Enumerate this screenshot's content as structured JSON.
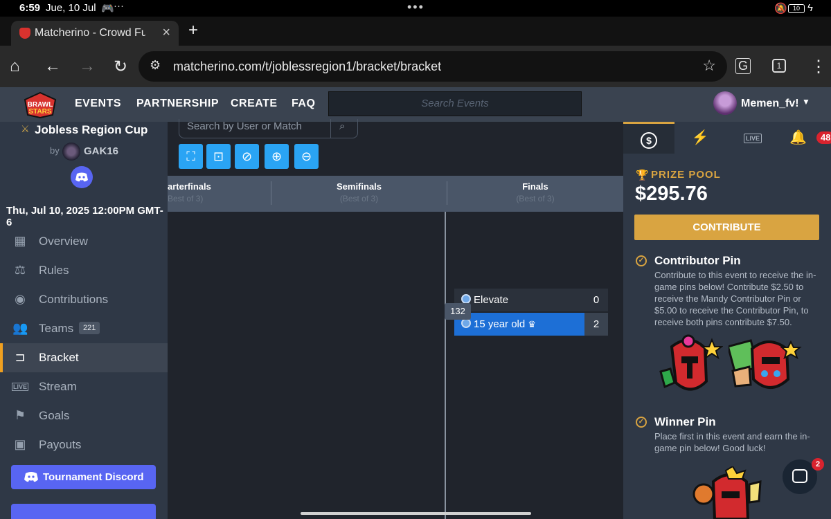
{
  "status_bar": {
    "time": "6:59",
    "date": "Jue, 10 Jul",
    "battery": "10"
  },
  "browser": {
    "tab_title": "Matcherino - Crowd Funding",
    "url": "matcherino.com/t/joblessregion1/bracket/bracket",
    "tab_count": "1"
  },
  "site_nav": {
    "links": [
      "EVENTS",
      "PARTNERSHIP",
      "CREATE",
      "FAQ"
    ],
    "search_placeholder": "Search Events",
    "username": "Memen_fv!"
  },
  "sidebar": {
    "cup_title": "Jobless Region Cup",
    "by_label": "by",
    "organizer": "GAK16",
    "event_date": "Thu, Jul 10, 2025 12:00PM GMT-6",
    "items": [
      {
        "label": "Overview",
        "icon": "grid-icon"
      },
      {
        "label": "Rules",
        "icon": "scale-icon"
      },
      {
        "label": "Contributions",
        "icon": "coins-icon"
      },
      {
        "label": "Teams",
        "icon": "users-icon",
        "badge": "221"
      },
      {
        "label": "Bracket",
        "icon": "bracket-icon",
        "active": true
      },
      {
        "label": "Stream",
        "icon": "live-icon"
      },
      {
        "label": "Goals",
        "icon": "flag-icon"
      },
      {
        "label": "Payouts",
        "icon": "money-icon"
      }
    ],
    "discord_button": "Tournament Discord"
  },
  "bracket": {
    "search_placeholder": "Search by User or Match",
    "rounds": [
      {
        "name": "arterfinals",
        "best_of": "Best of 3)"
      },
      {
        "name": "Semifinals",
        "best_of": "(Best of 3)"
      },
      {
        "name": "Finals",
        "best_of": "(Best of 3)"
      }
    ],
    "match": {
      "number": "132",
      "team1": {
        "name": "Elevate",
        "score": "0"
      },
      "team2": {
        "name": "15 year old",
        "score": "2"
      }
    }
  },
  "right_panel": {
    "tabs": [
      "dollar-icon",
      "lightning-icon",
      "LIVE",
      "bell-icon"
    ],
    "notification_count": "48",
    "prize_label": "PRIZE POOL",
    "prize_amount": "$295.76",
    "contribute_label": "CONTRIBUTE",
    "contributor_pin_title": "Contributor Pin",
    "contributor_pin_desc": "Contribute to this event to receive the in-game pins below! Contribute $2.50 to receive the Mandy Contributor Pin or $5.00 to receive the Contributor Pin, to receive both pins contribute $7.50.",
    "winner_pin_title": "Winner Pin",
    "winner_pin_desc": "Place first in this event and earn the in-game pin below! Good luck!"
  },
  "chat_badge": "2",
  "colors": {
    "accent_gold": "#d9a441",
    "accent_blue": "#2aa4f4",
    "discord": "#5865f2",
    "winner_blue": "#1d6fd6"
  }
}
